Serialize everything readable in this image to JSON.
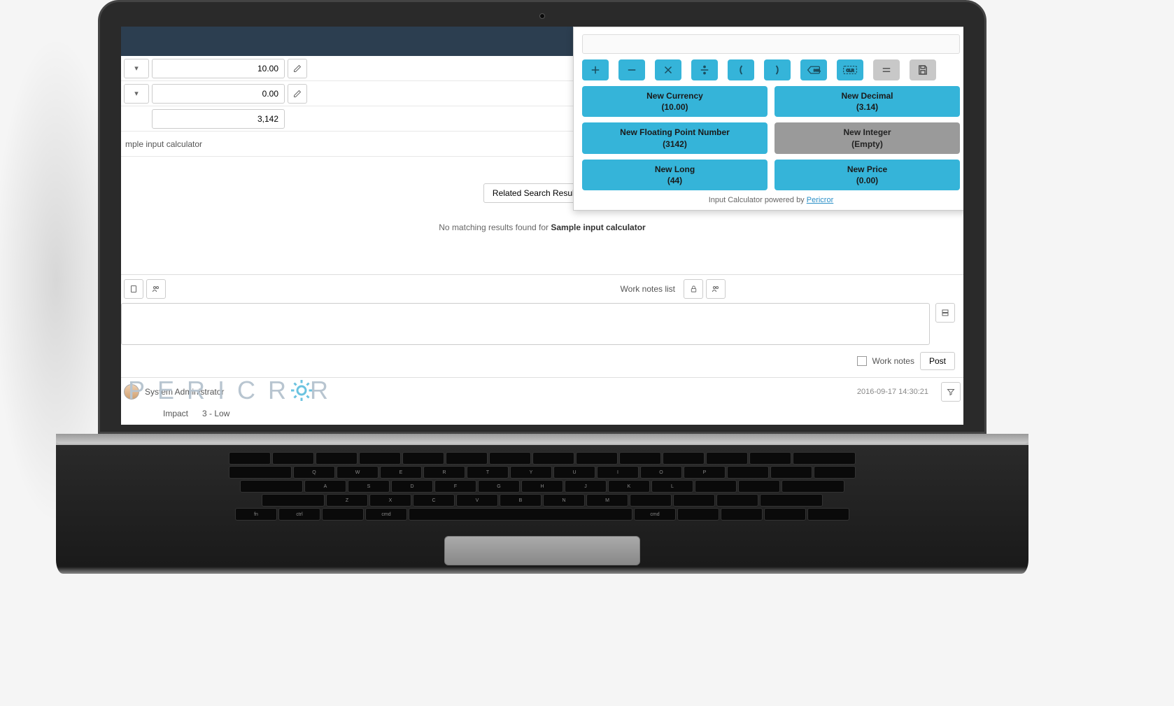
{
  "form": {
    "row1_value": "10.00",
    "row2_value": "0.00",
    "row3_value": "3,142",
    "row4_text": "mple input calculator"
  },
  "related": {
    "button_label": "Related Search Results",
    "no_match_prefix": "No matching results found for ",
    "no_match_term": "Sample input calculator"
  },
  "notes": {
    "list_label": "Work notes list",
    "checkbox_label": "Work notes",
    "post_label": "Post"
  },
  "activity": {
    "user": "System Administrator",
    "timestamp": "2016-09-17 14:30:21",
    "impact_label": "Impact",
    "impact_value": "3 - Low"
  },
  "watermark": "PERICROR",
  "calculator": {
    "values": [
      {
        "title": "New Currency",
        "sub": "(10.00)",
        "disabled": false
      },
      {
        "title": "New Decimal",
        "sub": "(3.14)",
        "disabled": false
      },
      {
        "title": "New Floating Point Number",
        "sub": "(3142)",
        "disabled": false
      },
      {
        "title": "New Integer",
        "sub": "(Empty)",
        "disabled": true
      },
      {
        "title": "New Long",
        "sub": "(44)",
        "disabled": false
      },
      {
        "title": "New Price",
        "sub": "(0.00)",
        "disabled": false
      }
    ],
    "footer_prefix": "Input Calculator powered by ",
    "footer_link": "Pericror"
  }
}
